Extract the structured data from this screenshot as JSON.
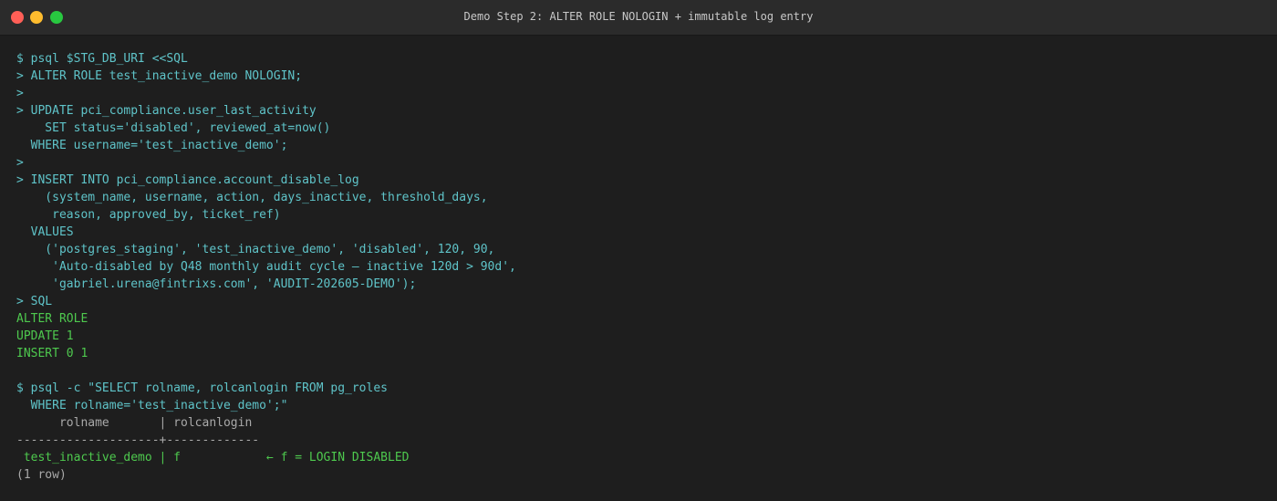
{
  "window": {
    "title": "Demo Step 2: ALTER ROLE NOLOGIN + immutable log entry",
    "colors": {
      "background": "#1e1e1e",
      "titlebar": "#2b2b2b",
      "command": "#5fc4c9",
      "success": "#4ec94e",
      "muted": "#a9a9a9"
    }
  },
  "terminal": {
    "lines": [
      {
        "text": "$ psql $STG_DB_URI <<SQL",
        "style": "cyan"
      },
      {
        "text": "> ALTER ROLE test_inactive_demo NOLOGIN;",
        "style": "cyan"
      },
      {
        "text": ">",
        "style": "cyan"
      },
      {
        "text": "> UPDATE pci_compliance.user_last_activity",
        "style": "cyan"
      },
      {
        "text": "    SET status='disabled', reviewed_at=now()",
        "style": "cyan"
      },
      {
        "text": "  WHERE username='test_inactive_demo';",
        "style": "cyan"
      },
      {
        "text": ">",
        "style": "cyan"
      },
      {
        "text": "> INSERT INTO pci_compliance.account_disable_log",
        "style": "cyan"
      },
      {
        "text": "    (system_name, username, action, days_inactive, threshold_days,",
        "style": "cyan"
      },
      {
        "text": "     reason, approved_by, ticket_ref)",
        "style": "cyan"
      },
      {
        "text": "  VALUES",
        "style": "cyan"
      },
      {
        "text": "    ('postgres_staging', 'test_inactive_demo', 'disabled', 120, 90,",
        "style": "cyan"
      },
      {
        "text": "     'Auto-disabled by Q48 monthly audit cycle — inactive 120d > 90d',",
        "style": "cyan"
      },
      {
        "text": "     'gabriel.urena@fintrixs.com', 'AUDIT-202605-DEMO');",
        "style": "cyan"
      },
      {
        "text": "> SQL",
        "style": "cyan"
      },
      {
        "text": "ALTER ROLE",
        "style": "green"
      },
      {
        "text": "UPDATE 1",
        "style": "green"
      },
      {
        "text": "INSERT 0 1",
        "style": "green"
      },
      {
        "text": "",
        "style": "cyan"
      },
      {
        "text": "$ psql -c \"SELECT rolname, rolcanlogin FROM pg_roles",
        "style": "cyan"
      },
      {
        "text": "  WHERE rolname='test_inactive_demo';\"",
        "style": "cyan"
      },
      {
        "text": "      rolname       | rolcanlogin",
        "style": "gray"
      },
      {
        "text": "--------------------+-------------",
        "style": "gray"
      },
      {
        "text": " test_inactive_demo | f            ← f = LOGIN DISABLED",
        "style": "green"
      },
      {
        "text": "(1 row)",
        "style": "gray"
      }
    ]
  }
}
